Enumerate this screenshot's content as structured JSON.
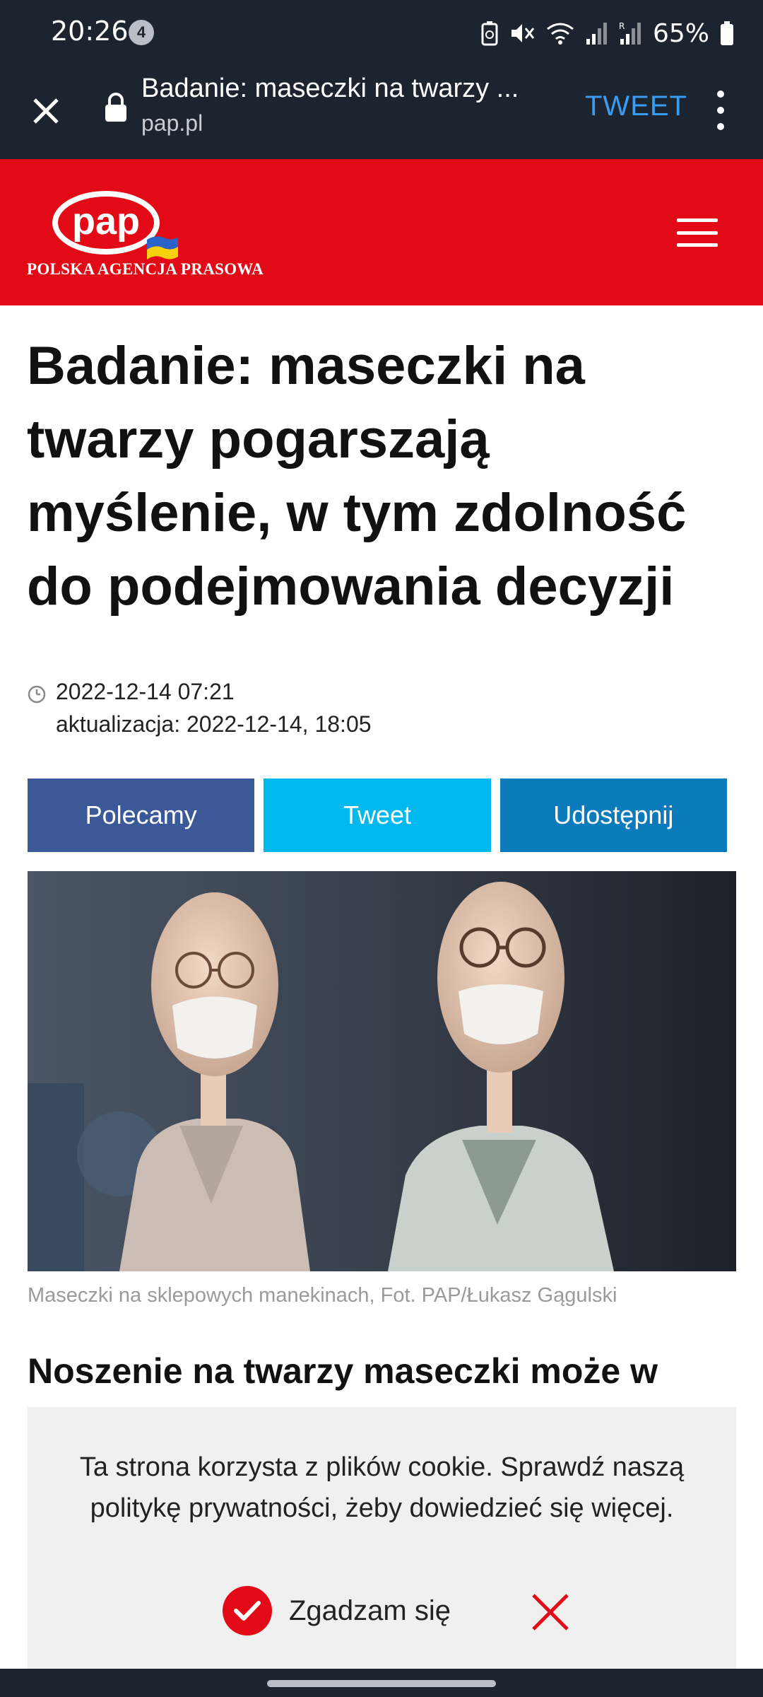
{
  "status_bar": {
    "time": "20:26",
    "notification_count": "4",
    "battery": "65%"
  },
  "browser": {
    "page_title": "Badanie: maseczki na twarzy ...",
    "url": "pap.pl",
    "tweet_label": "TWEET",
    "accent_color": "#3a9cf2"
  },
  "site": {
    "logo_text": "pap",
    "tagline": "POLSKA AGENCJA PRASOWA",
    "brand_color": "#e20a16"
  },
  "article": {
    "headline": "Badanie: maseczki na twarzy pogarszają myślenie, w tym zdolność do podejmowania decyzji",
    "date": "2022-12-14 07:21",
    "updated": "aktualizacja: 2022-12-14, 18:05",
    "share": {
      "facebook": "Polecamy",
      "twitter": "Tweet",
      "linkedin": "Udostępnij"
    },
    "caption": "Maseczki na sklepowych manekinach, Fot. PAP/Łukasz Gągulski",
    "lead": "Noszenie na twarzy maseczki może w"
  },
  "cookie_banner": {
    "text": "Ta strona korzysta z plików cookie. Sprawdź naszą politykę prywatności, żeby dowiedzieć się więcej.",
    "accept_label": "Zgadzam się"
  }
}
